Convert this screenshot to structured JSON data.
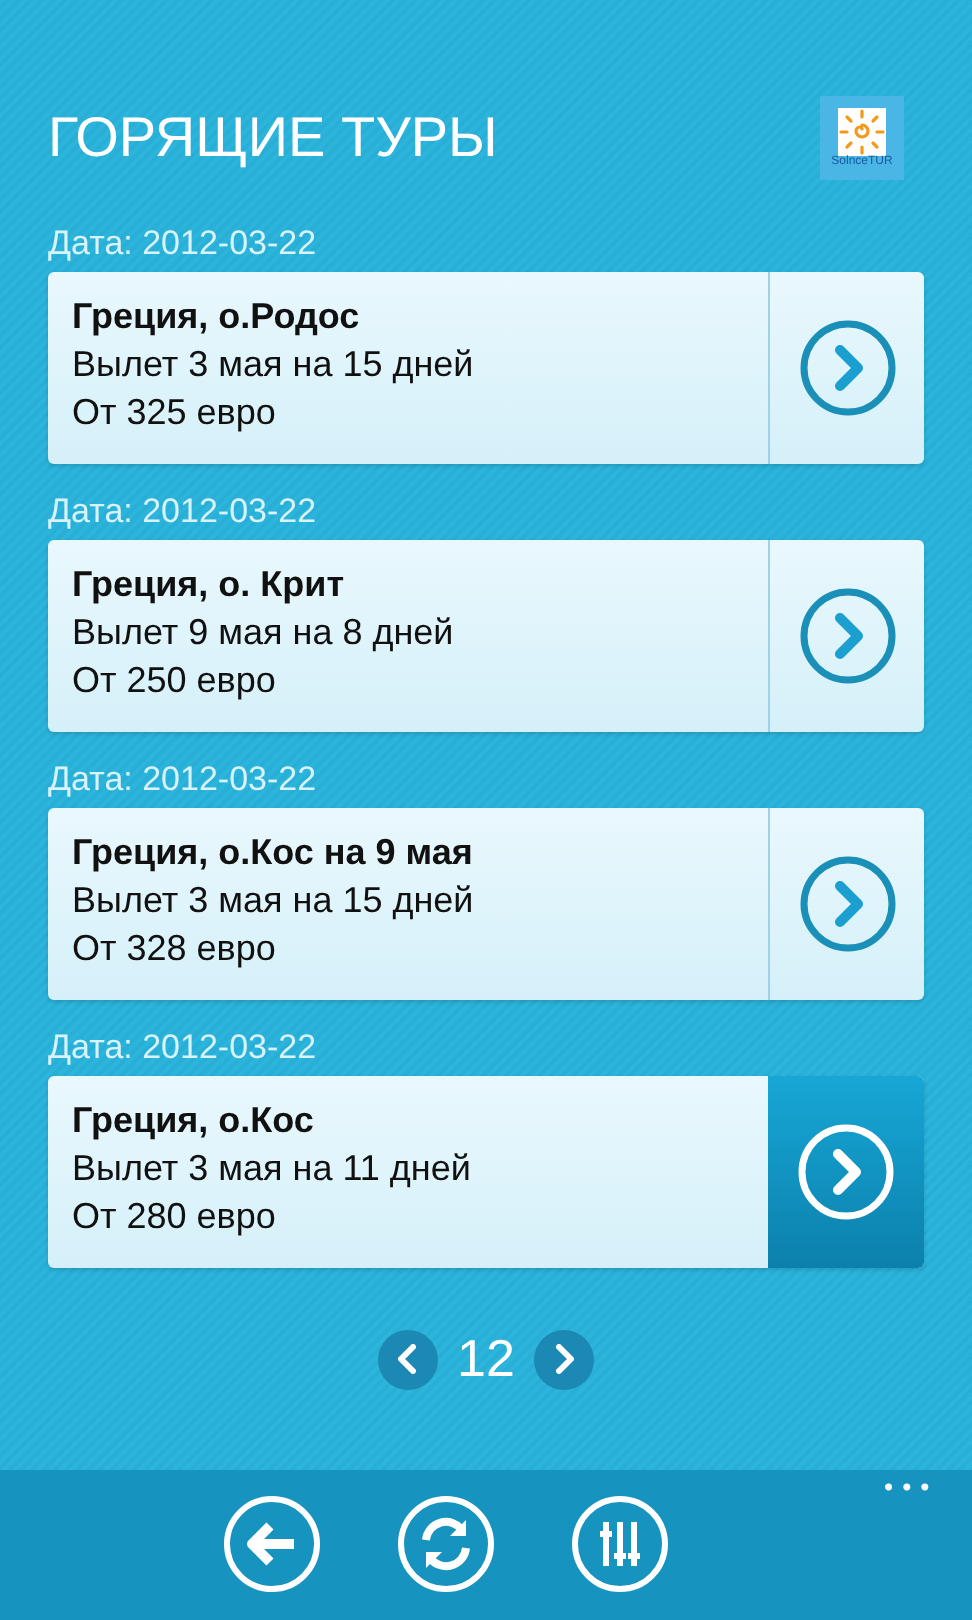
{
  "header": {
    "title": "ГОРЯЩИЕ ТУРЫ",
    "logo_text": "SolnceTUR"
  },
  "tours": [
    {
      "date": "Дата: 2012-03-22",
      "name": "Греция, о.Родос",
      "departure": "Вылет 3 мая на 15 дней",
      "price": "От 325 евро",
      "selected": false
    },
    {
      "date": "Дата: 2012-03-22",
      "name": "Греция, о. Крит",
      "departure": "Вылет 9 мая на 8 дней",
      "price": "От 250 евро",
      "selected": false
    },
    {
      "date": "Дата: 2012-03-22",
      "name": "Греция, о.Кос на 9 мая",
      "departure": "Вылет 3 мая на 15 дней",
      "price": "От 328 евро",
      "selected": false
    },
    {
      "date": "Дата: 2012-03-22",
      "name": "Греция, о.Кос",
      "departure": "Вылет 3 мая на 11 дней",
      "price": "От 280 евро",
      "selected": true
    }
  ],
  "pager": {
    "page": "12"
  },
  "app_bar": {
    "buttons": [
      {
        "kind": "back"
      },
      {
        "kind": "refresh"
      },
      {
        "kind": "filter"
      }
    ],
    "more": "•••"
  }
}
